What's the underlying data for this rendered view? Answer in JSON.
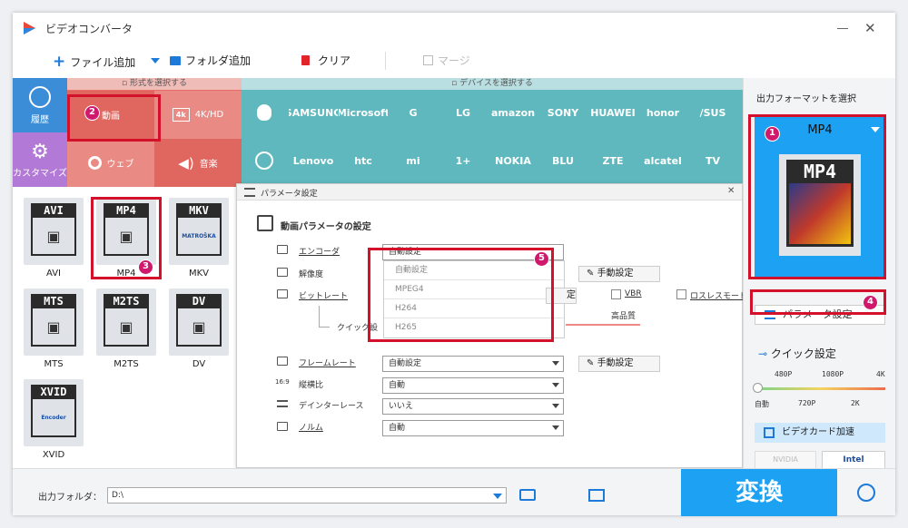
{
  "app": {
    "title": "ビデオコンバータ"
  },
  "toolbar": {
    "add_file": "ファイル追加",
    "add_folder": "フォルダ追加",
    "clear": "クリア",
    "merge": "マージ"
  },
  "tabs": {
    "history": "履歴",
    "customize": "カスタマイズ"
  },
  "format_section": {
    "header": "形式を選択する",
    "video": "動画",
    "hd": "4K/HD",
    "web": "ウェブ",
    "music": "音楽"
  },
  "device_section": {
    "header": "デバイスを選択する",
    "row1": [
      "SAMSUNG",
      "Microsoft",
      "G",
      "LG",
      "amazon",
      "SONY",
      "HUAWEI",
      "honor",
      "/SUS"
    ],
    "row2": [
      "Lenovo",
      "htc",
      "mi",
      "1+",
      "NOKIA",
      "BLU",
      "ZTE",
      "alcatel",
      "TV"
    ]
  },
  "formats": [
    {
      "label": "AVI",
      "name": "AVI"
    },
    {
      "label": "MP4",
      "name": "MP4"
    },
    {
      "label": "MKV",
      "name": "MKV",
      "sub": "MATROŠKA"
    },
    {
      "label": "MTS",
      "name": "MTS"
    },
    {
      "label": "M2TS",
      "name": "M2TS"
    },
    {
      "label": "DV",
      "name": "DV"
    },
    {
      "label": "XVID",
      "name": "XVID",
      "sub": "Encoder"
    }
  ],
  "params": {
    "title": "パラメータ設定",
    "section": "動画パラメータの設定",
    "encoder_label": "エンコーダ",
    "encoder_value": "自動設定",
    "encoder_options": [
      "自動設定",
      "MPEG4",
      "H264",
      "H265"
    ],
    "resolution_label": "解像度",
    "manual": "手動設定",
    "bitrate_label": "ビットレート",
    "bitrate_btn_tail": "定",
    "vbr": "VBR",
    "lossless": "ロスレスモード",
    "quick_label": "クイック設",
    "hq": "高品質",
    "framerate_label": "フレームレート",
    "framerate_value": "自動設定",
    "aspect_label": "縦横比",
    "aspect_value": "自動",
    "deinterlace_label": "デインターレース",
    "deinterlace_value": "いいえ",
    "norm_label": "ノルム",
    "norm_value": "自動"
  },
  "right": {
    "output_header": "出力フォーマットを選択",
    "format": "MP4",
    "param_btn": "パラメータ設定",
    "quick": "クイック設定",
    "q_top": [
      "480P",
      "1080P",
      "4K"
    ],
    "q_bottom": [
      "自動",
      "720P",
      "2K"
    ],
    "gpu": "ビデオカード加速",
    "nvidia": "NVIDIA",
    "intel": "Intel"
  },
  "bottom": {
    "folder_label": "出力フォルダ：",
    "folder_value": "D:\\",
    "convert": "変換"
  },
  "badges": [
    "1",
    "2",
    "3",
    "4",
    "5"
  ],
  "colors": {
    "red_tab": "#d9534f",
    "teal": "#5fb8be",
    "accent": "#1da1f2",
    "highlight": "#d4112b"
  }
}
